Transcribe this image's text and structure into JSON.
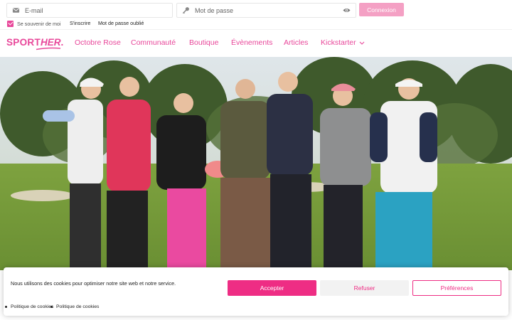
{
  "login": {
    "email_placeholder": "E-mail",
    "password_placeholder": "Mot de passe",
    "connect_label": "Connexion",
    "remember_label": "Se souvenir de moi",
    "signup_label": "S'inscrire",
    "forgot_label": "Mot de passe oublié"
  },
  "brand": {
    "part1": "SPORT",
    "part2": "HER",
    "period": "."
  },
  "nav": {
    "items": [
      "Octobre Rose",
      "Communauté",
      "Boutique",
      "Évènements",
      "Articles",
      "Kickstarter"
    ]
  },
  "cookie": {
    "text": "Nous utilisons des cookies pour optimiser notre site web et notre service.",
    "accept_label": "Accepter",
    "refuse_label": "Refuser",
    "prefs_label": "Préférences",
    "policy_links": [
      "Politique de cookies",
      "Politique de cookies"
    ]
  },
  "colors": {
    "brand_pink": "#e8479a",
    "accept_pink": "#ee2d84",
    "connect_disabled": "#f4a0c4"
  },
  "icons": [
    "envelope-icon",
    "key-icon",
    "eye-icon",
    "checkbox-icon",
    "chevron-down-icon"
  ]
}
